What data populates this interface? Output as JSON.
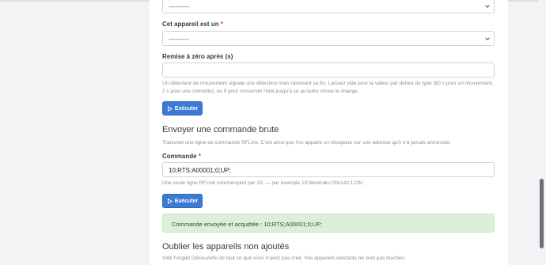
{
  "top_select": {
    "value": "---------"
  },
  "device_type": {
    "label": "Cet appareil est un",
    "required_mark": "*",
    "value": "---------"
  },
  "reset_field": {
    "label": "Remise à zéro après (s)",
    "value": "",
    "help": "Un détecteur de mouvement signale une détection mais rarement sa fin. Laissez vide pour la valeur par défaut du type (60 s pour un mouvement, 2 s pour une sonnette), ou 0 pour conserver l'état jusqu'à ce qu'autre chose le change."
  },
  "execute_button_1": {
    "label": "Exécuter"
  },
  "raw_command": {
    "title": "Envoyer une commande brute",
    "description": "Transmet une ligne de commande RFLink. C'est ainsi que l'on appaire un récepteur sur une adresse qu'il n'a jamais annoncée.",
    "field_label": "Commande",
    "required_mark": "*",
    "value": "10;RTS;A00001;0;UP;",
    "help": "Une seule ligne RFLink commençant par 10; — par exemple 10;NewKaku;00c142;1;ON;"
  },
  "execute_button_2": {
    "label": "Exécuter"
  },
  "success_alert": {
    "text": "Commande envoyée et acquittée : 10;RTS;A00001;0;UP;"
  },
  "forget_section": {
    "title": "Oublier les appareils non ajoutés",
    "description": "Vide l'onglet Découverte de tout ce que vous n'avez pas créé. Vos appareils existants ne sont pas touchés."
  },
  "icons": {
    "select_chevron": "chevron-down-icon",
    "button_icon": "play-icon"
  },
  "colors": {
    "primary": "#3b7bd4",
    "success_bg": "#dcefd8",
    "required": "#dc3545"
  }
}
